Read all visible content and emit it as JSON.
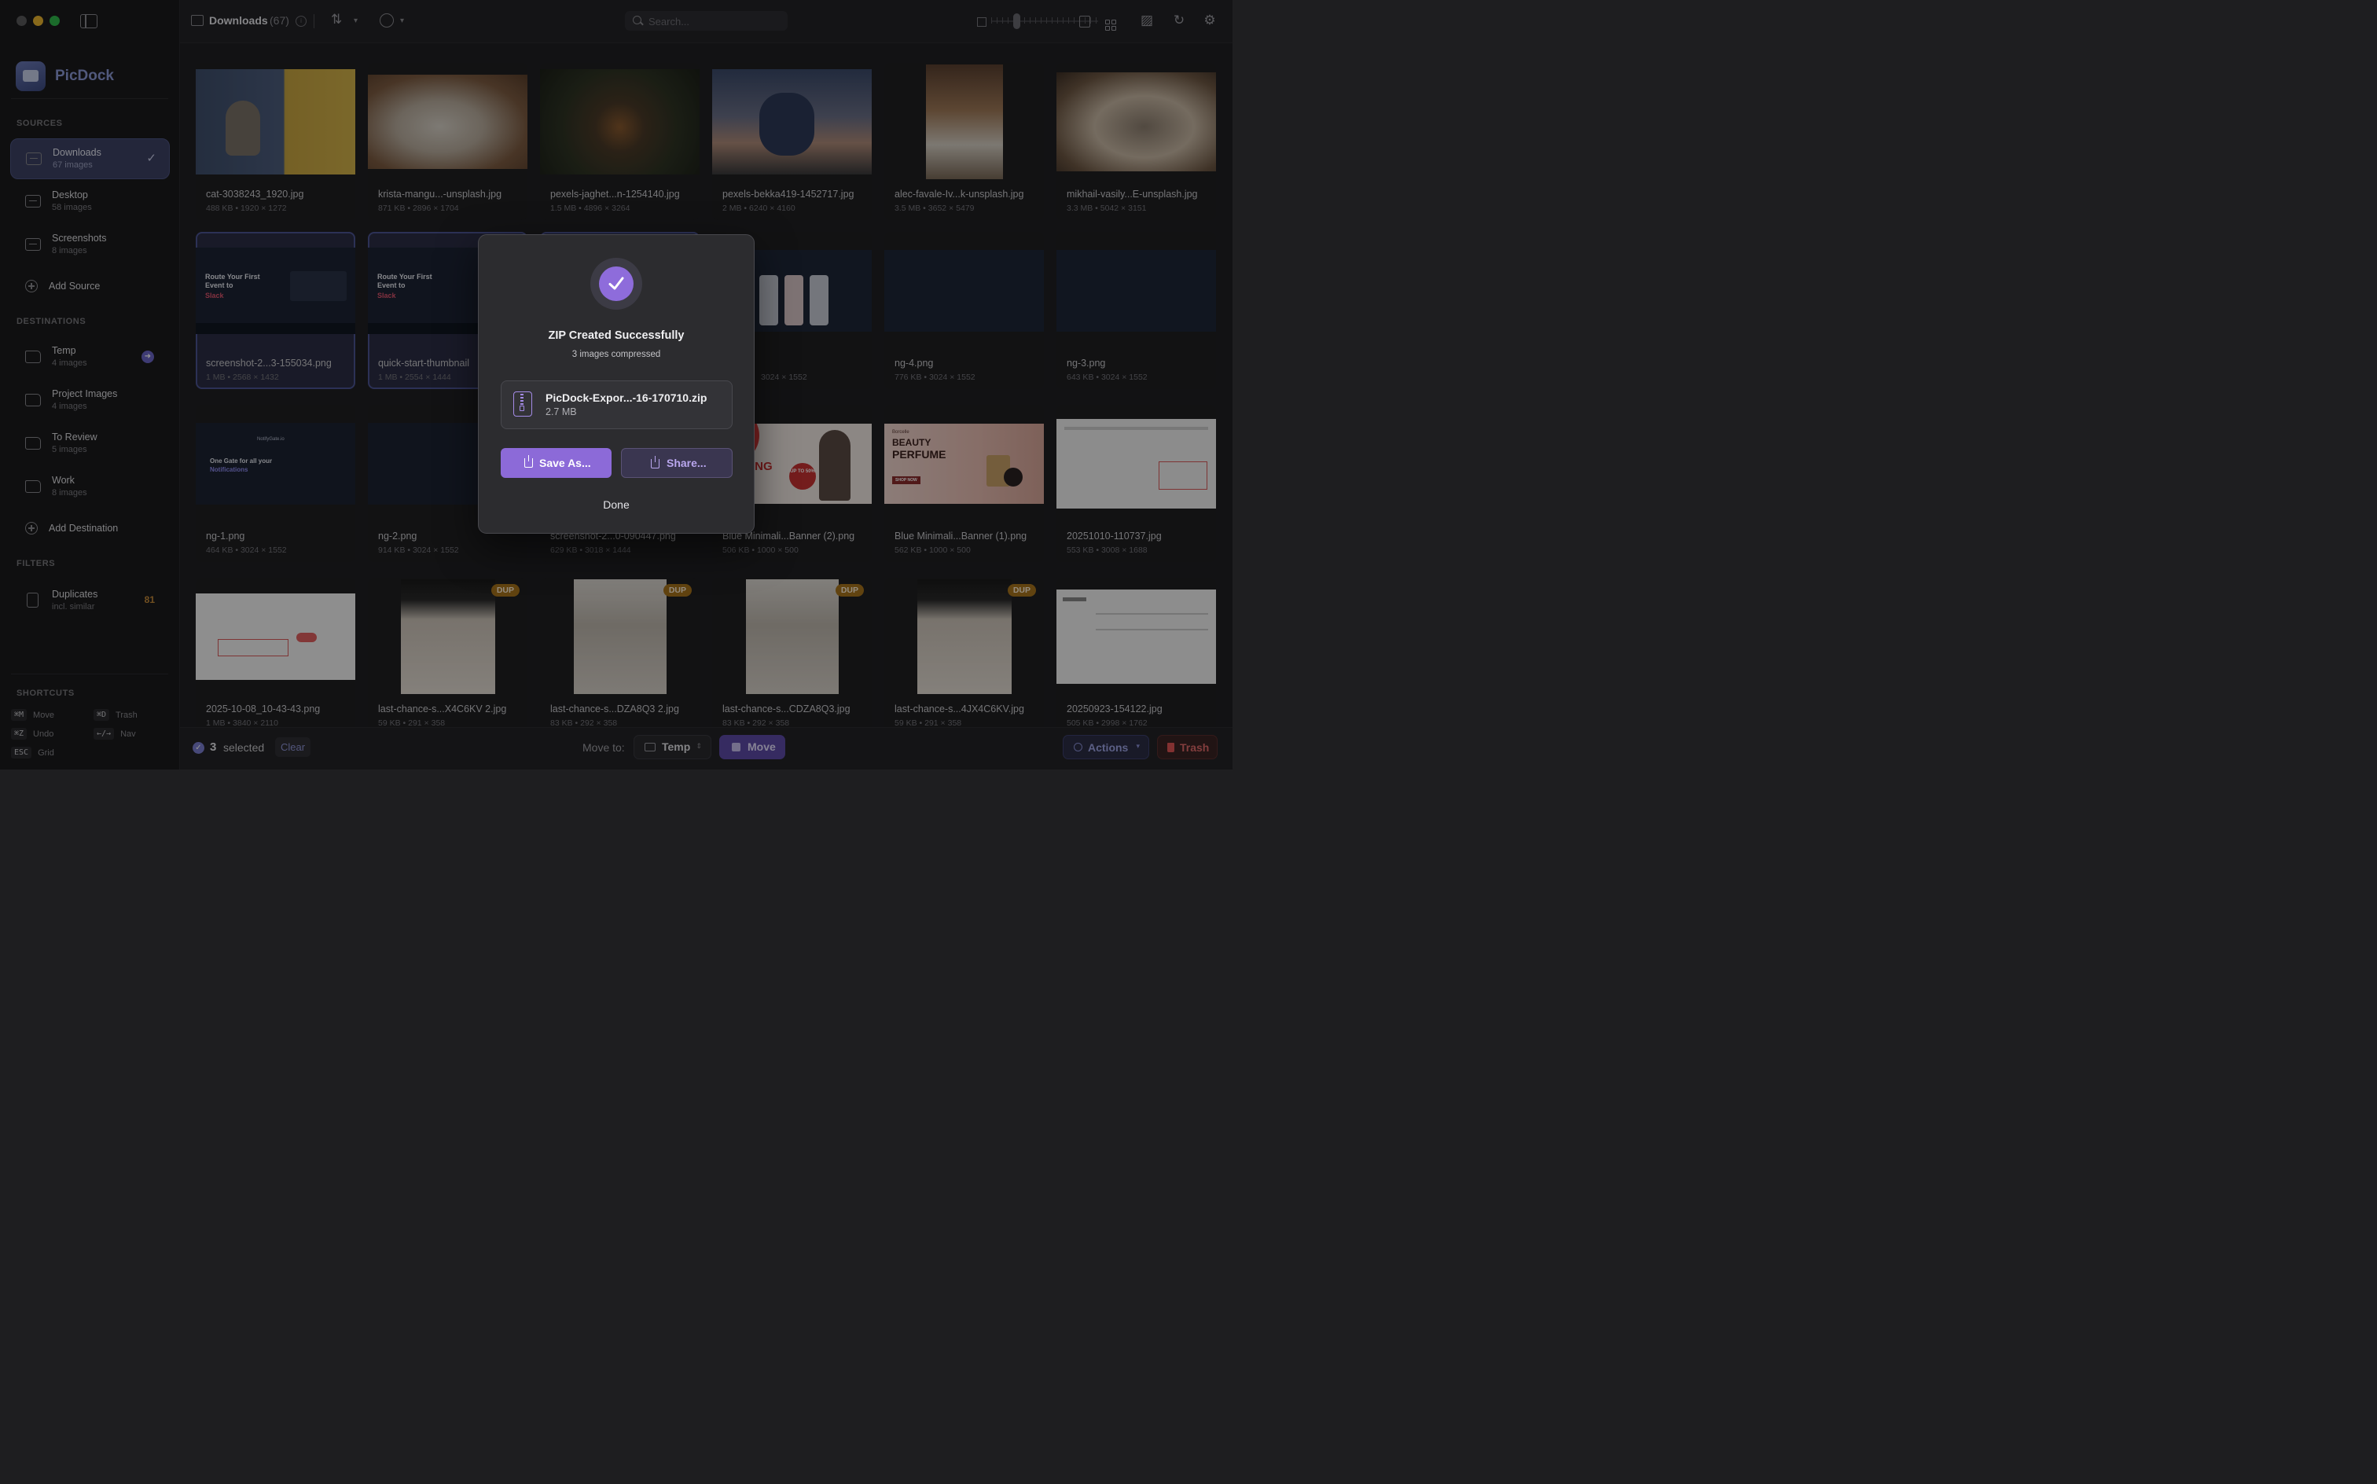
{
  "window": {
    "title": "Downloads",
    "count": "(67)"
  },
  "brand": {
    "name": "PicDock"
  },
  "search": {
    "placeholder": "Search..."
  },
  "sidebar": {
    "sources_label": "SOURCES",
    "sources": [
      {
        "title": "Downloads",
        "sub": "67 images",
        "active": true
      },
      {
        "title": "Desktop",
        "sub": "58 images"
      },
      {
        "title": "Screenshots",
        "sub": "8 images"
      }
    ],
    "add_source": "Add Source",
    "destinations_label": "DESTINATIONS",
    "destinations": [
      {
        "title": "Temp",
        "sub": "4 images"
      },
      {
        "title": "Project Images",
        "sub": "4 images"
      },
      {
        "title": "To Review",
        "sub": "5 images"
      },
      {
        "title": "Work",
        "sub": "8 images"
      }
    ],
    "add_destination": "Add Destination",
    "filters_label": "FILTERS",
    "filters": [
      {
        "title": "Duplicates",
        "sub": "incl. similar",
        "count": "81"
      }
    ],
    "shortcuts_label": "SHORTCUTS",
    "shortcuts": [
      {
        "key": "⌘M",
        "label": "Move"
      },
      {
        "key": "⌘D",
        "label": "Trash"
      },
      {
        "key": "⌘Z",
        "label": "Undo"
      },
      {
        "key": "←/→",
        "label": "Nav"
      },
      {
        "key": "ESC",
        "label": "Grid"
      }
    ]
  },
  "grid": {
    "dup_label": "DUP",
    "items": [
      {
        "name": "cat-3038243_1920.jpg",
        "meta": "488 KB  •  1920 × 1272"
      },
      {
        "name": "krista-mangu...-unsplash.jpg",
        "meta": "871 KB  •  2896 × 1704"
      },
      {
        "name": "pexels-jaghet...n-1254140.jpg",
        "meta": "1.5 MB  •  4896 × 3264"
      },
      {
        "name": "pexels-bekka419-1452717.jpg",
        "meta": "2 MB  •  6240 × 4160"
      },
      {
        "name": "alec-favale-Iv...k-unsplash.jpg",
        "meta": "3.5 MB  •  3652 × 5479"
      },
      {
        "name": "mikhail-vasily...E-unsplash.jpg",
        "meta": "3.3 MB  •  5042 × 3151"
      },
      {
        "name": "screenshot-2...3-155034.png",
        "meta": "1 MB  •  2568 × 1432",
        "selected": true
      },
      {
        "name": "quick-start-thumbnail",
        "meta": "1 MB  •  2554 × 1444",
        "selected": true
      },
      {
        "name": "",
        "meta": "",
        "selected": true
      },
      {
        "name": "ng",
        "meta": "3024 × 1552"
      },
      {
        "name": "ng-4.png",
        "meta": "776 KB  •  3024 × 1552"
      },
      {
        "name": "ng-3.png",
        "meta": "643 KB  •  3024 × 1552"
      },
      {
        "name": "ng-1.png",
        "meta": "464 KB  •  3024 × 1552"
      },
      {
        "name": "ng-2.png",
        "meta": "914 KB  •  3024 × 1552"
      },
      {
        "name": "screenshot-2...0-090447.png",
        "meta": "629 KB  •  3018 × 1444"
      },
      {
        "name": "Blue Minimali...Banner (2).png",
        "meta": "506 KB  •  1000 × 500"
      },
      {
        "name": "Blue Minimali...Banner (1).png",
        "meta": "562 KB  •  1000 × 500"
      },
      {
        "name": "20251010-110737.jpg",
        "meta": "553 KB  •  3008 × 1688"
      },
      {
        "name": "2025-10-08_10-43-43.png",
        "meta": "1 MB  •  3840 × 2110"
      },
      {
        "name": "last-chance-s...X4C6KV 2.jpg",
        "meta": "59 KB  •  291 × 358",
        "dup": true
      },
      {
        "name": "last-chance-s...DZA8Q3 2.jpg",
        "meta": "83 KB  •  292 × 358",
        "dup": true
      },
      {
        "name": "last-chance-s...CDZA8Q3.jpg",
        "meta": "83 KB  •  292 × 358",
        "dup": true
      },
      {
        "name": "last-chance-s...4JX4C6KV.jpg",
        "meta": "59 KB  •  291 × 358",
        "dup": true
      },
      {
        "name": "20250923-154122.jpg",
        "meta": "505 KB  •  2998 × 1762"
      }
    ],
    "thumb_text": {
      "route_title": "Route Your First Event to",
      "route_accent": "Slack",
      "notify_brand": "NotifyGate.io",
      "notify_head": "One Gate for all your",
      "notify_accent": "Notifications",
      "beauty_line1": "BEAUTY",
      "beauty_line2": "PERFUME",
      "beauty_brand": "Borcelle",
      "beauty_cta": "SHOP NOW",
      "sale_text": "NE PPING",
      "sale_pct": "UP TO 50%"
    }
  },
  "bottombar": {
    "selected_count": "3",
    "selected_label": "selected",
    "clear": "Clear",
    "move_to": "Move to:",
    "destination": "Temp",
    "move": "Move",
    "actions": "Actions",
    "trash": "Trash"
  },
  "modal": {
    "title": "ZIP Created Successfully",
    "subtitle": "3 images compressed",
    "file_name": "PicDock-Expor...-16-170710.zip",
    "file_size": "2.7 MB",
    "save_as": "Save As...",
    "share": "Share...",
    "done": "Done"
  },
  "colors": {
    "accent": "#8c6ad8",
    "selection": "#3d4265",
    "dup_badge": "#a8741d",
    "trash": "#e05555"
  }
}
